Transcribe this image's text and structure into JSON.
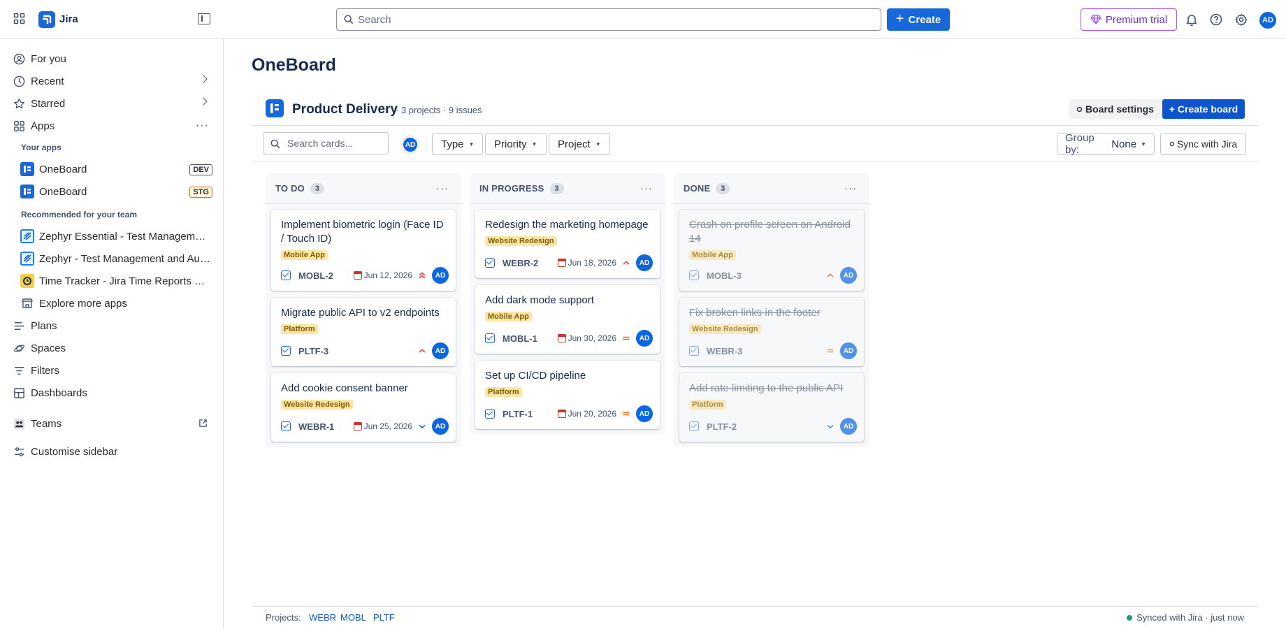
{
  "topbar": {
    "app_name": "Jira",
    "search_placeholder": "Search",
    "create_label": "Create",
    "premium_label": "Premium trial",
    "avatar_initials": "AD"
  },
  "sidebar": {
    "nav": {
      "for_you": "For you",
      "recent": "Recent",
      "starred": "Starred",
      "apps": "Apps",
      "plans": "Plans",
      "spaces": "Spaces",
      "filters": "Filters",
      "dashboards": "Dashboards",
      "teams": "Teams",
      "customise": "Customise sidebar"
    },
    "your_apps_title": "Your apps",
    "your_apps": [
      {
        "name": "OneBoard",
        "badge": "DEV"
      },
      {
        "name": "OneBoard",
        "badge": "STG"
      }
    ],
    "recommended_title": "Recommended for your team",
    "recommended": [
      {
        "name": "Zephyr Essential - Test Management for Jira"
      },
      {
        "name": "Zephyr - Test Management and Automation"
      },
      {
        "name": "Time Tracker - Jira Time Reports & Timesheets"
      }
    ],
    "explore_label": "Explore more apps"
  },
  "page": {
    "title": "OneBoard",
    "board_name": "Product Delivery",
    "board_meta": "· 3 projects · 9 issues",
    "board_settings_label": "Board settings",
    "create_board_label": "+ Create board"
  },
  "filters": {
    "search_placeholder": "Search cards...",
    "avatar_initials": "AD",
    "type_label": "Type",
    "priority_label": "Priority",
    "project_label": "Project",
    "group_by_label": "Group by:",
    "group_by_value": "None",
    "sync_label": "Sync with Jira"
  },
  "columns": [
    {
      "title": "TO DO",
      "count": "3",
      "cards": [
        {
          "title": "Implement biometric login (Face ID / Touch ID)",
          "tag": "Mobile App",
          "key": "MOBL-2",
          "date": "Jun 12, 2026",
          "priority": "highest",
          "assignee": "AD"
        },
        {
          "title": "Migrate public API to v2 endpoints",
          "tag": "Platform",
          "key": "PLTF-3",
          "date": "",
          "priority": "high",
          "assignee": "AD"
        },
        {
          "title": "Add cookie consent banner",
          "tag": "Website Redesign",
          "key": "WEBR-1",
          "date": "Jun 25, 2026",
          "priority": "low",
          "assignee": "AD"
        }
      ]
    },
    {
      "title": "IN PROGRESS",
      "count": "3",
      "cards": [
        {
          "title": "Redesign the marketing homepage",
          "tag": "Website Redesign",
          "key": "WEBR-2",
          "date": "Jun 18, 2026",
          "priority": "high",
          "assignee": "AD"
        },
        {
          "title": "Add dark mode support",
          "tag": "Mobile App",
          "key": "MOBL-1",
          "date": "Jun 30, 2026",
          "priority": "medium",
          "assignee": "AD"
        },
        {
          "title": "Set up CI/CD pipeline",
          "tag": "Platform",
          "key": "PLTF-1",
          "date": "Jun 20, 2026",
          "priority": "medium",
          "assignee": "AD"
        }
      ]
    },
    {
      "title": "DONE",
      "count": "3",
      "cards": [
        {
          "title": "Crash on profile screen on Android 14",
          "tag": "Mobile App",
          "key": "MOBL-3",
          "date": "",
          "priority": "high",
          "assignee": "AD"
        },
        {
          "title": "Fix broken links in the footer",
          "tag": "Website Redesign",
          "key": "WEBR-3",
          "date": "",
          "priority": "medium",
          "assignee": "AD"
        },
        {
          "title": "Add rate limiting to the public API",
          "tag": "Platform",
          "key": "PLTF-2",
          "date": "",
          "priority": "low",
          "assignee": "AD"
        }
      ]
    }
  ],
  "footer": {
    "projects_label": "Projects:",
    "projects": [
      "WEBR",
      "MOBL",
      "PLTF"
    ],
    "synced_text": "Synced with Jira · just now"
  },
  "colors": {
    "brand_blue": "#1868db",
    "premium_purple": "#a054f6",
    "tag_yellow": "#fce4a6",
    "priority_red": "#e2483d",
    "priority_orange": "#e56910",
    "priority_blue": "#1868db",
    "synced_green": "#22a06b"
  }
}
